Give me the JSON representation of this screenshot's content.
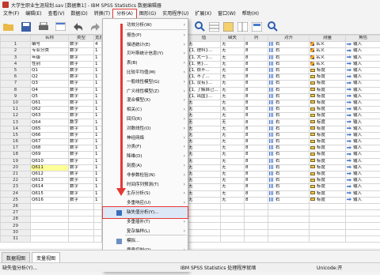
{
  "window": {
    "title": "大学生职业生涯规划.sav [数据集1] - IBM SPSS Statistics 数据编辑器"
  },
  "menubar": [
    "文件(F)",
    "编辑(E)",
    "查看(V)",
    "数据(D)",
    "转换(T)",
    "分析(A)",
    "图形(G)",
    "实用程序(U)",
    "扩展(X)",
    "窗口(W)",
    "帮助(H)"
  ],
  "columns": [
    "",
    "名称",
    "类型",
    "宽度",
    "",
    "值",
    "缺失",
    "列",
    "对齐",
    "测量",
    "角色"
  ],
  "rows": [
    [
      "1",
      "编号",
      "数字",
      "4",
      "",
      "无",
      "无",
      "8",
      "右",
      "名义",
      "输入"
    ],
    [
      "2",
      "专业分类",
      "数字",
      "1",
      "",
      "{1, 理科}...",
      "无",
      "8",
      "右",
      "名义",
      "输入"
    ],
    [
      "3",
      "年级",
      "数字",
      "1",
      "",
      "{1, 大一}...",
      "无",
      "8",
      "右",
      "名义",
      "输入"
    ],
    [
      "4",
      "性别",
      "数字",
      "1",
      "",
      "{1, 男}...",
      "无",
      "8",
      "右",
      "名义",
      "输入"
    ],
    [
      "5",
      "Q1",
      "数字",
      "1",
      "",
      "{1, 很不...",
      "无",
      "8",
      "右",
      "标度",
      "输入"
    ],
    [
      "6",
      "Q2",
      "数字",
      "1",
      "",
      "{1, 不了...",
      "无",
      "8",
      "右",
      "标度",
      "输入"
    ],
    [
      "7",
      "Q3",
      "数字",
      "1",
      "",
      "{1, 没有}...",
      "无",
      "8",
      "右",
      "标度",
      "输入"
    ],
    [
      "8",
      "Q4",
      "数字",
      "1",
      "",
      "{1, 了解自己...",
      "无",
      "8",
      "右",
      "标度",
      "输入"
    ],
    [
      "9",
      "Q5",
      "数字",
      "1",
      "",
      "{1, 出国}...",
      "无",
      "8",
      "右",
      "标度",
      "输入"
    ],
    [
      "10",
      "Q61",
      "数字",
      "1",
      "",
      "无",
      "无",
      "8",
      "右",
      "标度",
      "输入"
    ],
    [
      "11",
      "Q62",
      "数字",
      "1",
      "",
      "无",
      "无",
      "8",
      "右",
      "标度",
      "输入"
    ],
    [
      "12",
      "Q63",
      "数字",
      "1",
      "",
      "无",
      "无",
      "8",
      "右",
      "标度",
      "输入"
    ],
    [
      "13",
      "Q64",
      "数字",
      "1",
      "",
      "无",
      "无",
      "8",
      "右",
      "标度",
      "输入"
    ],
    [
      "14",
      "Q65",
      "数字",
      "1",
      "",
      "无",
      "无",
      "8",
      "右",
      "标度",
      "输入"
    ],
    [
      "15",
      "Q66",
      "数字",
      "1",
      "",
      "无",
      "无",
      "8",
      "右",
      "标度",
      "输入"
    ],
    [
      "16",
      "Q67",
      "数字",
      "1",
      "",
      "无",
      "无",
      "8",
      "右",
      "标度",
      "输入"
    ],
    [
      "17",
      "Q68",
      "数字",
      "1",
      "",
      "无",
      "无",
      "8",
      "右",
      "标度",
      "输入"
    ],
    [
      "18",
      "Q69",
      "数字",
      "1",
      "",
      "无",
      "无",
      "8",
      "右",
      "标度",
      "输入"
    ],
    [
      "19",
      "Q610",
      "数字",
      "1",
      "",
      "无",
      "无",
      "8",
      "右",
      "标度",
      "输入"
    ],
    [
      "20",
      "Q611",
      "数字",
      "1",
      "",
      "无",
      "无",
      "8",
      "右",
      "标度",
      "输入"
    ],
    [
      "21",
      "Q612",
      "数字",
      "1",
      "",
      "无",
      "无",
      "8",
      "右",
      "标度",
      "输入"
    ],
    [
      "22",
      "Q613",
      "数字",
      "1",
      "",
      "无",
      "无",
      "8",
      "右",
      "标度",
      "输入"
    ],
    [
      "23",
      "Q614",
      "数字",
      "1",
      "",
      "无",
      "无",
      "8",
      "右",
      "标度",
      "输入"
    ],
    [
      "24",
      "Q615",
      "数字",
      "1",
      "",
      "无",
      "无",
      "8",
      "右",
      "标度",
      "输入"
    ],
    [
      "25",
      "Q616",
      "数字",
      "1",
      "",
      "无",
      "无",
      "8",
      "右",
      "标度",
      "输入"
    ],
    [
      "26",
      "",
      "",
      "",
      "",
      "",
      "",
      "",
      "",
      "",
      ""
    ],
    [
      "27",
      "",
      "",
      "",
      "",
      "",
      "",
      "",
      "",
      "",
      ""
    ],
    [
      "28",
      "",
      "",
      "",
      "",
      "",
      "",
      "",
      "",
      "",
      ""
    ],
    [
      "29",
      "",
      "",
      "",
      "",
      "",
      "",
      "",
      "",
      "",
      ""
    ],
    [
      "30",
      "",
      "",
      "",
      "",
      "",
      "",
      "",
      "",
      "",
      ""
    ],
    [
      "31",
      "",
      "",
      "",
      "",
      "",
      "",
      "",
      "",
      "",
      ""
    ]
  ],
  "analyze_menu": {
    "items": [
      {
        "label": "功效分析(W)",
        "sub": true
      },
      {
        "label": "报告(P)",
        "sub": true
      },
      {
        "label": "描述统计(E)",
        "sub": true
      },
      {
        "label": "贝叶斯统计信息(Y)",
        "sub": true
      },
      {
        "label": "表(B)",
        "sub": true
      },
      {
        "label": "比较平均值(M)",
        "sub": true
      },
      {
        "label": "一般线性模型(G)",
        "sub": true
      },
      {
        "label": "广义线性模型(Z)",
        "sub": true
      },
      {
        "label": "混合模型(X)",
        "sub": true
      },
      {
        "label": "相关(C)",
        "sub": true
      },
      {
        "label": "回归(R)",
        "sub": true
      },
      {
        "label": "对数线性(O)",
        "sub": true
      },
      {
        "label": "神经网络",
        "sub": true
      },
      {
        "label": "分类(F)",
        "sub": true
      },
      {
        "label": "降维(D)",
        "sub": true
      },
      {
        "label": "刻度(A)",
        "sub": true
      },
      {
        "label": "非参数检验(N)",
        "sub": true
      },
      {
        "label": "时间序列预测(T)",
        "sub": true
      },
      {
        "label": "生存分析(S)",
        "sub": true
      },
      {
        "label": "多重响应(U)",
        "sub": true
      },
      {
        "label": "缺失值分析(Y)...",
        "sub": false,
        "highlight": true
      },
      {
        "label": "多重插补(T)",
        "sub": true
      },
      {
        "label": "复杂抽样(L)",
        "sub": true
      },
      {
        "label": "模拟...",
        "sub": false
      },
      {
        "label": "质量控制(Q)",
        "sub": true
      },
      {
        "label": "空间和时间建模...",
        "sub": true
      },
      {
        "label": "直销(K)",
        "sub": true
      }
    ]
  },
  "tabs": [
    "数据视图",
    "变量视图"
  ],
  "status": {
    "left": "缺失值分析(Y)...",
    "center": "IBM SPSS Statistics 处理程序就绪",
    "unicode": "Unicode:开"
  }
}
